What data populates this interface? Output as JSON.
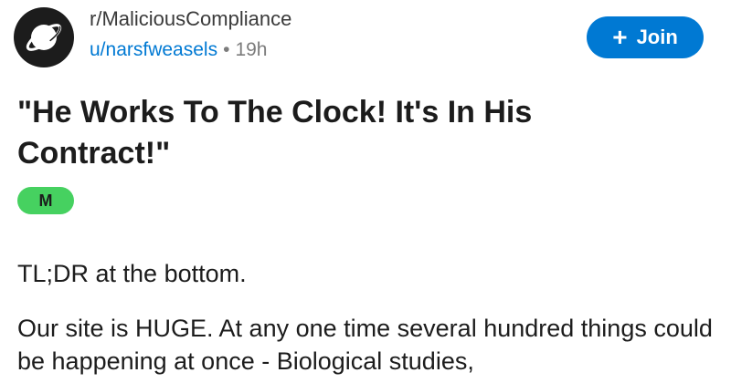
{
  "header": {
    "subreddit": "r/MaliciousCompliance",
    "user": "u/narsfweasels",
    "separator": "•",
    "age": "19h",
    "join_label": "Join",
    "join_icon": "plus-icon",
    "avatar_icon": "planet-icon"
  },
  "post": {
    "title": "\"He Works To The Clock! It's In His Contract!\"",
    "flair": "M",
    "paragraphs": [
      "TL;DR at the bottom.",
      "Our site is HUGE. At any one time several hundred things could be happening at once - Biological studies,"
    ]
  },
  "colors": {
    "accent": "#0079d3",
    "flair": "#46d160",
    "text": "#1c1c1c",
    "muted": "#7c7c7c"
  }
}
